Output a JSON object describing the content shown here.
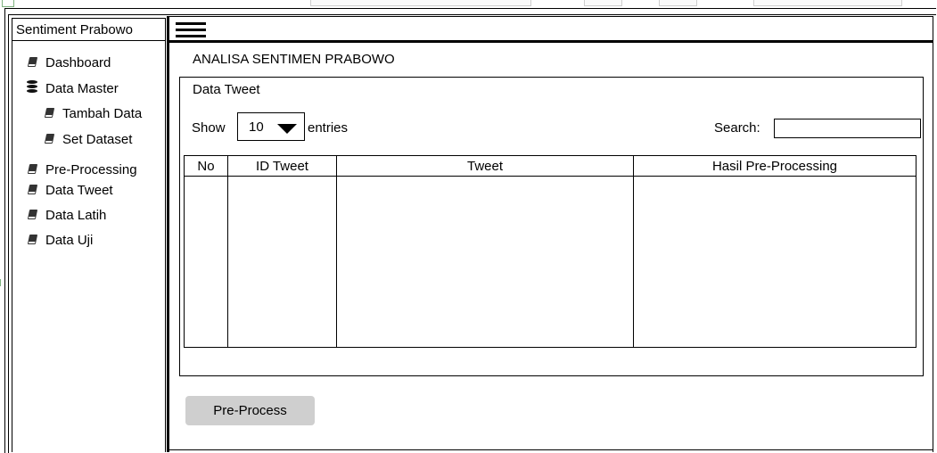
{
  "sidebar": {
    "brand": "Sentiment Prabowo",
    "items": [
      {
        "label": "Dashboard",
        "icon": "book-icon"
      },
      {
        "label": "Data Master",
        "icon": "database-icon"
      },
      {
        "label": "Tambah Data",
        "icon": "book-icon"
      },
      {
        "label": "Set Dataset",
        "icon": "book-icon"
      },
      {
        "label": "Pre-Processing",
        "icon": "book-icon"
      },
      {
        "label": "Data Tweet",
        "icon": "book-icon"
      },
      {
        "label": "Data Latih",
        "icon": "book-icon"
      },
      {
        "label": "Data Uji",
        "icon": "book-icon"
      }
    ]
  },
  "header": {
    "menu_icon": "hamburger-icon"
  },
  "main": {
    "page_title": "ANALISA SENTIMEN PRABOWO",
    "panel_title": "Data Tweet",
    "show_label": "Show",
    "entries_value": "10",
    "entries_label": "entries",
    "search_label": "Search:",
    "search_value": "",
    "table": {
      "columns": [
        "No",
        "ID Tweet",
        "Tweet",
        "Hasil Pre-Processing"
      ],
      "rows": []
    },
    "action_button": "Pre-Process"
  }
}
